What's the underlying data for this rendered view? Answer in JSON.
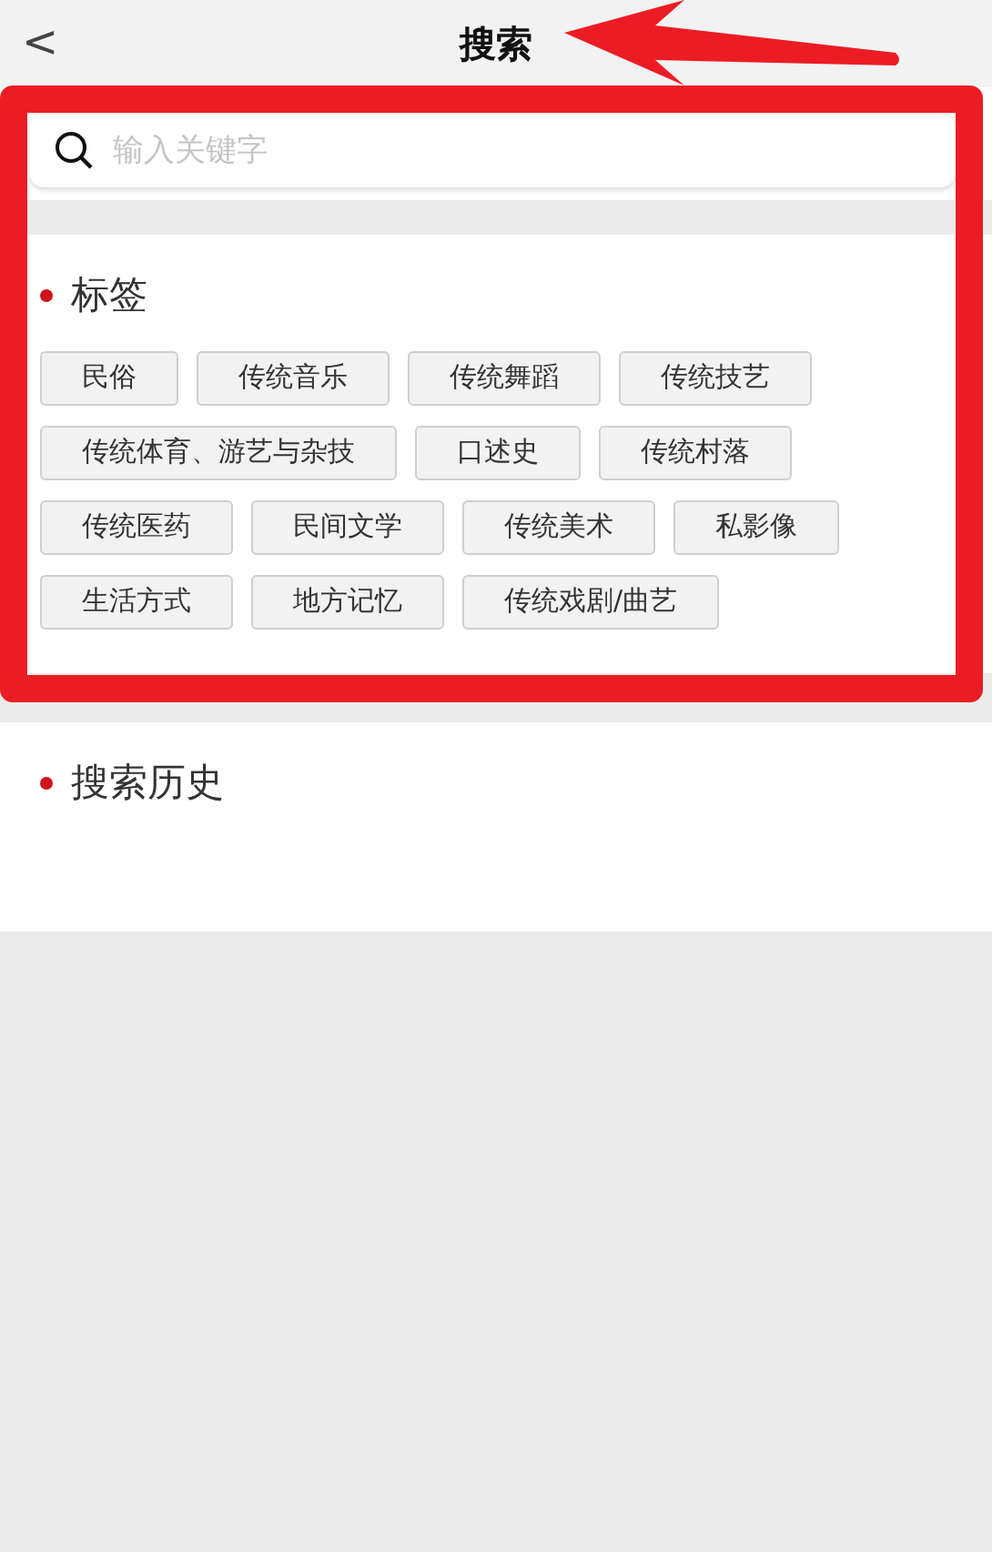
{
  "header": {
    "back": "<",
    "title": "搜索"
  },
  "search": {
    "placeholder": "输入关键字"
  },
  "tags_section": {
    "title": "标签",
    "tags": [
      "民俗",
      "传统音乐",
      "传统舞蹈",
      "传统技艺",
      "传统体育、游艺与杂技",
      "口述史",
      "传统村落",
      "传统医药",
      "民间文学",
      "传统美术",
      "私影像",
      "生活方式",
      "地方记忆",
      "传统戏剧/曲艺"
    ]
  },
  "history_section": {
    "title": "搜索历史"
  }
}
